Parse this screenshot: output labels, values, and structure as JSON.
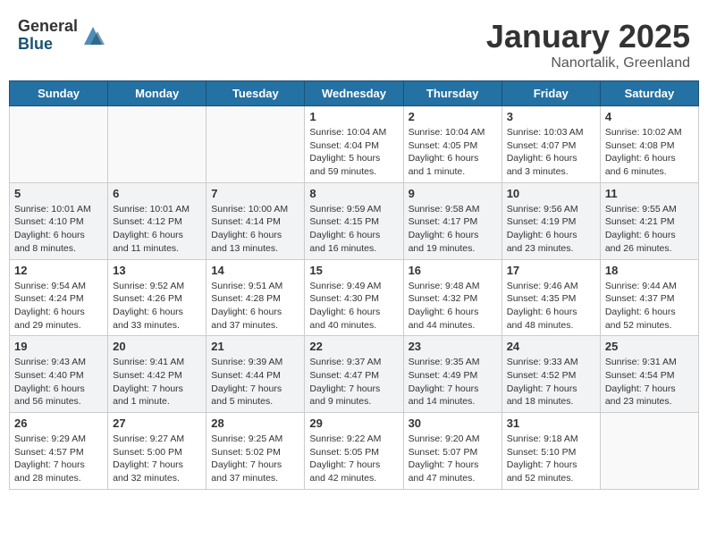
{
  "header": {
    "logo_general": "General",
    "logo_blue": "Blue",
    "month_title": "January 2025",
    "location": "Nanortalik, Greenland"
  },
  "weekdays": [
    "Sunday",
    "Monday",
    "Tuesday",
    "Wednesday",
    "Thursday",
    "Friday",
    "Saturday"
  ],
  "weeks": [
    [
      {
        "day": "",
        "info": ""
      },
      {
        "day": "",
        "info": ""
      },
      {
        "day": "",
        "info": ""
      },
      {
        "day": "1",
        "info": "Sunrise: 10:04 AM\nSunset: 4:04 PM\nDaylight: 5 hours\nand 59 minutes."
      },
      {
        "day": "2",
        "info": "Sunrise: 10:04 AM\nSunset: 4:05 PM\nDaylight: 6 hours\nand 1 minute."
      },
      {
        "day": "3",
        "info": "Sunrise: 10:03 AM\nSunset: 4:07 PM\nDaylight: 6 hours\nand 3 minutes."
      },
      {
        "day": "4",
        "info": "Sunrise: 10:02 AM\nSunset: 4:08 PM\nDaylight: 6 hours\nand 6 minutes."
      }
    ],
    [
      {
        "day": "5",
        "info": "Sunrise: 10:01 AM\nSunset: 4:10 PM\nDaylight: 6 hours\nand 8 minutes."
      },
      {
        "day": "6",
        "info": "Sunrise: 10:01 AM\nSunset: 4:12 PM\nDaylight: 6 hours\nand 11 minutes."
      },
      {
        "day": "7",
        "info": "Sunrise: 10:00 AM\nSunset: 4:14 PM\nDaylight: 6 hours\nand 13 minutes."
      },
      {
        "day": "8",
        "info": "Sunrise: 9:59 AM\nSunset: 4:15 PM\nDaylight: 6 hours\nand 16 minutes."
      },
      {
        "day": "9",
        "info": "Sunrise: 9:58 AM\nSunset: 4:17 PM\nDaylight: 6 hours\nand 19 minutes."
      },
      {
        "day": "10",
        "info": "Sunrise: 9:56 AM\nSunset: 4:19 PM\nDaylight: 6 hours\nand 23 minutes."
      },
      {
        "day": "11",
        "info": "Sunrise: 9:55 AM\nSunset: 4:21 PM\nDaylight: 6 hours\nand 26 minutes."
      }
    ],
    [
      {
        "day": "12",
        "info": "Sunrise: 9:54 AM\nSunset: 4:24 PM\nDaylight: 6 hours\nand 29 minutes."
      },
      {
        "day": "13",
        "info": "Sunrise: 9:52 AM\nSunset: 4:26 PM\nDaylight: 6 hours\nand 33 minutes."
      },
      {
        "day": "14",
        "info": "Sunrise: 9:51 AM\nSunset: 4:28 PM\nDaylight: 6 hours\nand 37 minutes."
      },
      {
        "day": "15",
        "info": "Sunrise: 9:49 AM\nSunset: 4:30 PM\nDaylight: 6 hours\nand 40 minutes."
      },
      {
        "day": "16",
        "info": "Sunrise: 9:48 AM\nSunset: 4:32 PM\nDaylight: 6 hours\nand 44 minutes."
      },
      {
        "day": "17",
        "info": "Sunrise: 9:46 AM\nSunset: 4:35 PM\nDaylight: 6 hours\nand 48 minutes."
      },
      {
        "day": "18",
        "info": "Sunrise: 9:44 AM\nSunset: 4:37 PM\nDaylight: 6 hours\nand 52 minutes."
      }
    ],
    [
      {
        "day": "19",
        "info": "Sunrise: 9:43 AM\nSunset: 4:40 PM\nDaylight: 6 hours\nand 56 minutes."
      },
      {
        "day": "20",
        "info": "Sunrise: 9:41 AM\nSunset: 4:42 PM\nDaylight: 7 hours\nand 1 minute."
      },
      {
        "day": "21",
        "info": "Sunrise: 9:39 AM\nSunset: 4:44 PM\nDaylight: 7 hours\nand 5 minutes."
      },
      {
        "day": "22",
        "info": "Sunrise: 9:37 AM\nSunset: 4:47 PM\nDaylight: 7 hours\nand 9 minutes."
      },
      {
        "day": "23",
        "info": "Sunrise: 9:35 AM\nSunset: 4:49 PM\nDaylight: 7 hours\nand 14 minutes."
      },
      {
        "day": "24",
        "info": "Sunrise: 9:33 AM\nSunset: 4:52 PM\nDaylight: 7 hours\nand 18 minutes."
      },
      {
        "day": "25",
        "info": "Sunrise: 9:31 AM\nSunset: 4:54 PM\nDaylight: 7 hours\nand 23 minutes."
      }
    ],
    [
      {
        "day": "26",
        "info": "Sunrise: 9:29 AM\nSunset: 4:57 PM\nDaylight: 7 hours\nand 28 minutes."
      },
      {
        "day": "27",
        "info": "Sunrise: 9:27 AM\nSunset: 5:00 PM\nDaylight: 7 hours\nand 32 minutes."
      },
      {
        "day": "28",
        "info": "Sunrise: 9:25 AM\nSunset: 5:02 PM\nDaylight: 7 hours\nand 37 minutes."
      },
      {
        "day": "29",
        "info": "Sunrise: 9:22 AM\nSunset: 5:05 PM\nDaylight: 7 hours\nand 42 minutes."
      },
      {
        "day": "30",
        "info": "Sunrise: 9:20 AM\nSunset: 5:07 PM\nDaylight: 7 hours\nand 47 minutes."
      },
      {
        "day": "31",
        "info": "Sunrise: 9:18 AM\nSunset: 5:10 PM\nDaylight: 7 hours\nand 52 minutes."
      },
      {
        "day": "",
        "info": ""
      }
    ]
  ]
}
